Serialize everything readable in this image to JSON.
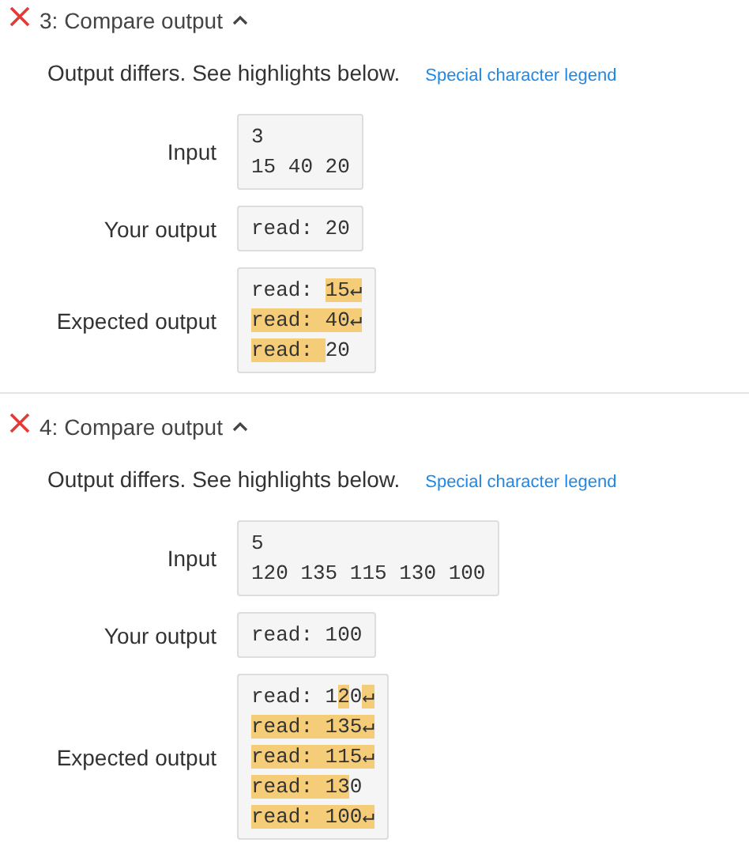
{
  "tests": [
    {
      "title": "3: Compare output",
      "passed": false,
      "expanded": true,
      "message": "Output differs. See highlights below.",
      "legend_link": "Special character legend",
      "rows": [
        {
          "label": "Input",
          "lines": [
            [
              {
                "text": "3",
                "highlighted": false
              }
            ],
            [
              {
                "text": "15 40 20",
                "highlighted": false
              }
            ]
          ]
        },
        {
          "label": "Your output",
          "lines": [
            [
              {
                "text": "read: 20",
                "highlighted": false
              }
            ]
          ]
        },
        {
          "label": "Expected output",
          "lines": [
            [
              {
                "text": "read: ",
                "highlighted": false
              },
              {
                "text": "15↵",
                "highlighted": true
              }
            ],
            [
              {
                "text": "read: 40↵",
                "highlighted": true
              }
            ],
            [
              {
                "text": "read: ",
                "highlighted": true
              },
              {
                "text": "20",
                "highlighted": false
              }
            ]
          ]
        }
      ]
    },
    {
      "title": "4: Compare output",
      "passed": false,
      "expanded": true,
      "message": "Output differs. See highlights below.",
      "legend_link": "Special character legend",
      "rows": [
        {
          "label": "Input",
          "lines": [
            [
              {
                "text": "5",
                "highlighted": false
              }
            ],
            [
              {
                "text": "120 135 115 130 100",
                "highlighted": false
              }
            ]
          ]
        },
        {
          "label": "Your output",
          "lines": [
            [
              {
                "text": "read: 100",
                "highlighted": false
              }
            ]
          ]
        },
        {
          "label": "Expected output",
          "lines": [
            [
              {
                "text": "read: 1",
                "highlighted": false
              },
              {
                "text": "2",
                "highlighted": true
              },
              {
                "text": "0",
                "highlighted": false
              },
              {
                "text": "↵",
                "highlighted": true
              }
            ],
            [
              {
                "text": "read: 135↵",
                "highlighted": true
              }
            ],
            [
              {
                "text": "read: 115↵",
                "highlighted": true
              }
            ],
            [
              {
                "text": "read: 13",
                "highlighted": true
              },
              {
                "text": "0",
                "highlighted": false
              }
            ],
            [
              {
                "text": "read: 100↵",
                "highlighted": true
              }
            ]
          ]
        }
      ]
    }
  ]
}
